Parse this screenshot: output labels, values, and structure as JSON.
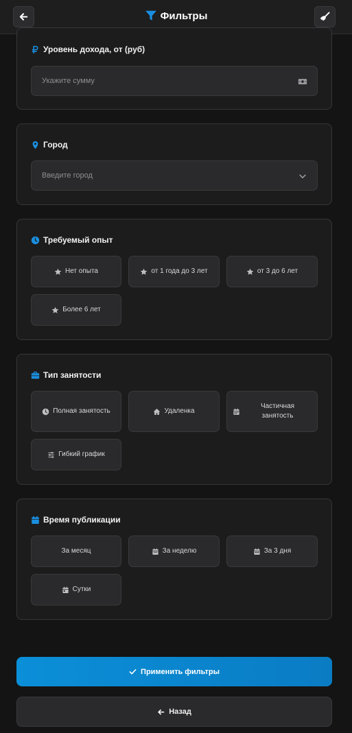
{
  "header": {
    "title": "Фильтры",
    "back_icon": "arrow-left-icon",
    "clear_icon": "broom-icon",
    "title_icon": "filter-icon"
  },
  "colors": {
    "accent": "#0a84d0",
    "background": "#141414",
    "card": "#1c1c1d",
    "chip": "#2a2a2c",
    "border": "#37373a"
  },
  "income": {
    "title": "Уровень дохода, от (руб)",
    "icon": "ruble-icon",
    "placeholder": "Укажите сумму",
    "field_icon": "money-icon"
  },
  "city": {
    "title": "Город",
    "icon": "map-pin-icon",
    "placeholder": "Введите город",
    "field_icon": "chevron-down-icon"
  },
  "experience": {
    "title": "Требуемый опыт",
    "icon": "clock-icon",
    "options": [
      {
        "label": "Нет опыта",
        "icon": "star-icon"
      },
      {
        "label": "от 1 года до 3 лет",
        "icon": "star-icon"
      },
      {
        "label": "от 3 до 6 лет",
        "icon": "star-icon"
      },
      {
        "label": "Более 6 лет",
        "icon": "star-icon"
      }
    ]
  },
  "employment": {
    "title": "Тип занятости",
    "icon": "briefcase-icon",
    "options": [
      {
        "label": "Полная занятость",
        "icon": "clock-icon"
      },
      {
        "label": "Удаленка",
        "icon": "home-icon"
      },
      {
        "label": "Частичная занятость",
        "icon": "calendar-icon"
      },
      {
        "label": "Гибкий график",
        "icon": "sliders-icon"
      }
    ]
  },
  "published": {
    "title": "Время публикации",
    "icon": "calendar-icon",
    "options": [
      {
        "label": "За месяц",
        "icon": ""
      },
      {
        "label": "За неделю",
        "icon": "calendar-icon"
      },
      {
        "label": "За 3 дня",
        "icon": "calendar-icon"
      },
      {
        "label": "Сутки",
        "icon": "calendar-icon"
      }
    ]
  },
  "actions": {
    "apply_label": "Применить фильтры",
    "apply_icon": "check-icon",
    "back_label": "Назад",
    "back_icon": "arrow-left-icon"
  }
}
